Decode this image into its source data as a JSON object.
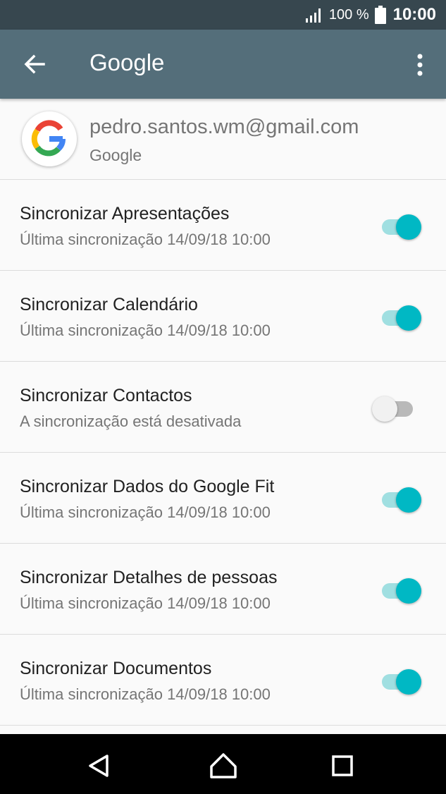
{
  "status_bar": {
    "signal_icon": "signal-icon",
    "battery_percent": "100 %",
    "battery_icon": "battery-icon",
    "time": "10:00"
  },
  "app_bar": {
    "back_icon": "arrow-back-icon",
    "title": "Google",
    "menu_icon": "more-vert-icon",
    "color": "#546e7a"
  },
  "account": {
    "email": "pedro.santos.wm@gmail.com",
    "type": "Google",
    "icon": "google-g-icon"
  },
  "sync_items": [
    {
      "title": "Sincronizar Apresentações",
      "subtitle": "Última sincronização 14/09/18 10:00",
      "enabled": true
    },
    {
      "title": "Sincronizar Calendário",
      "subtitle": "Última sincronização 14/09/18 10:00",
      "enabled": true
    },
    {
      "title": "Sincronizar Contactos",
      "subtitle": "A sincronização está desativada",
      "enabled": false
    },
    {
      "title": "Sincronizar Dados do Google Fit",
      "subtitle": "Última sincronização 14/09/18 10:00",
      "enabled": true
    },
    {
      "title": "Sincronizar Detalhes de pessoas",
      "subtitle": "Última sincronização 14/09/18 10:00",
      "enabled": true
    },
    {
      "title": "Sincronizar Documentos",
      "subtitle": "Última sincronização 14/09/18 10:00",
      "enabled": true
    }
  ],
  "nav_bar": {
    "back_icon": "nav-back-icon",
    "home_icon": "nav-home-icon",
    "recents_icon": "nav-recents-icon"
  },
  "colors": {
    "toggle_on": "#00b8c4",
    "toggle_on_track": "#a0dfe1",
    "toggle_off": "#f1f1f1"
  }
}
